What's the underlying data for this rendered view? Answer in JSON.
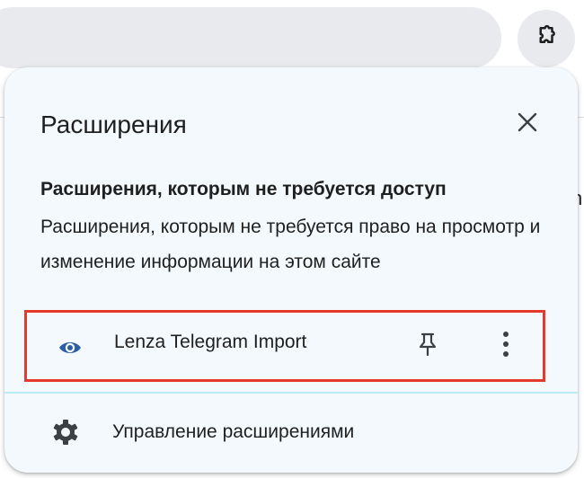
{
  "toolbar": {
    "omnibox_label": "",
    "edge_text": "n"
  },
  "panel": {
    "title": "Расширения",
    "section_heading": "Расширения, которым не требуется доступ",
    "section_description": "Расширения, которым не требуется право на просмотр и изменение информации на этом сайте",
    "extensions": [
      {
        "name": "Lenza Telegram Import",
        "icon": "lenza-eye-icon",
        "pinned": false,
        "highlighted": true
      }
    ],
    "manage_label": "Управление расширениями"
  },
  "colors": {
    "panel_background": "#f3f9fc",
    "highlight_border": "#e43a2e",
    "divider": "#b9ecf2",
    "text": "#1f1f1f",
    "extension_icon": "#2b5ea8"
  },
  "icons": {
    "toolbar_extensions": "puzzle-piece-icon",
    "close": "close-icon",
    "pin": "pin-icon",
    "more": "more-vertical-icon",
    "manage": "gear-icon"
  }
}
